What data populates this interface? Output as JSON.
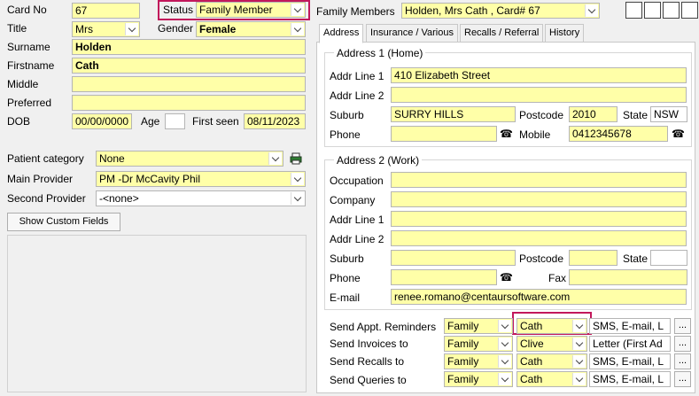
{
  "left": {
    "card_no_label": "Card No",
    "card_no": "67",
    "status_label": "Status",
    "status_value": "Family Member",
    "title_label": "Title",
    "title_value": "Mrs",
    "gender_label": "Gender",
    "gender_value": "Female",
    "surname_label": "Surname",
    "surname_value": "Holden",
    "firstname_label": "Firstname",
    "firstname_value": "Cath",
    "middle_label": "Middle",
    "middle_value": "",
    "preferred_label": "Preferred",
    "preferred_value": "",
    "dob_label": "DOB",
    "dob_value": "00/00/0000",
    "age_label": "Age",
    "age_value": "",
    "first_seen_label": "First seen",
    "first_seen_value": "08/11/2023",
    "patient_category_label": "Patient category",
    "patient_category_value": "None",
    "main_provider_label": "Main Provider",
    "main_provider_value": "PM -Dr McCavity Phil",
    "second_provider_label": "Second Provider",
    "second_provider_value": "-<none>",
    "show_custom_fields": "Show Custom Fields"
  },
  "family": {
    "label": "Family Members",
    "value": "Holden, Mrs Cath , Card# 67"
  },
  "tabs": [
    "Address",
    "Insurance / Various",
    "Recalls / Referral",
    "History"
  ],
  "address1": {
    "title": "Address 1 (Home)",
    "addr1_label": "Addr Line 1",
    "addr1_value": "410 Elizabeth Street",
    "addr2_label": "Addr Line 2",
    "addr2_value": "",
    "suburb_label": "Suburb",
    "suburb_value": "SURRY HILLS",
    "postcode_label": "Postcode",
    "postcode_value": "2010",
    "state_label": "State",
    "state_value": "NSW",
    "phone_label": "Phone",
    "phone_value": "",
    "mobile_label": "Mobile",
    "mobile_value": "0412345678"
  },
  "address2": {
    "title": "Address 2 (Work)",
    "occupation_label": "Occupation",
    "company_label": "Company",
    "addr1_label": "Addr Line 1",
    "addr2_label": "Addr Line 2",
    "suburb_label": "Suburb",
    "postcode_label": "Postcode",
    "state_label": "State",
    "phone_label": "Phone",
    "fax_label": "Fax",
    "email_label": "E-mail",
    "email_value": "renee.romano@centaursoftware.com"
  },
  "send": {
    "rows": [
      {
        "label": "Send Appt. Reminders",
        "who": "Family",
        "person": "Cath",
        "method": "SMS, E-mail, L"
      },
      {
        "label": "Send Invoices to",
        "who": "Family",
        "person": "Clive",
        "method": "Letter (First Ad"
      },
      {
        "label": "Send Recalls to",
        "who": "Family",
        "person": "Cath",
        "method": "SMS, E-mail, L"
      },
      {
        "label": "Send Queries to",
        "who": "Family",
        "person": "Cath",
        "method": "SMS, E-mail, L"
      }
    ],
    "more_label": "..."
  },
  "icons": {
    "phone": "☎",
    "printer": "printer-icon"
  },
  "colors": {
    "field_bg": "#ffffa8",
    "highlight": "#c2185b"
  }
}
